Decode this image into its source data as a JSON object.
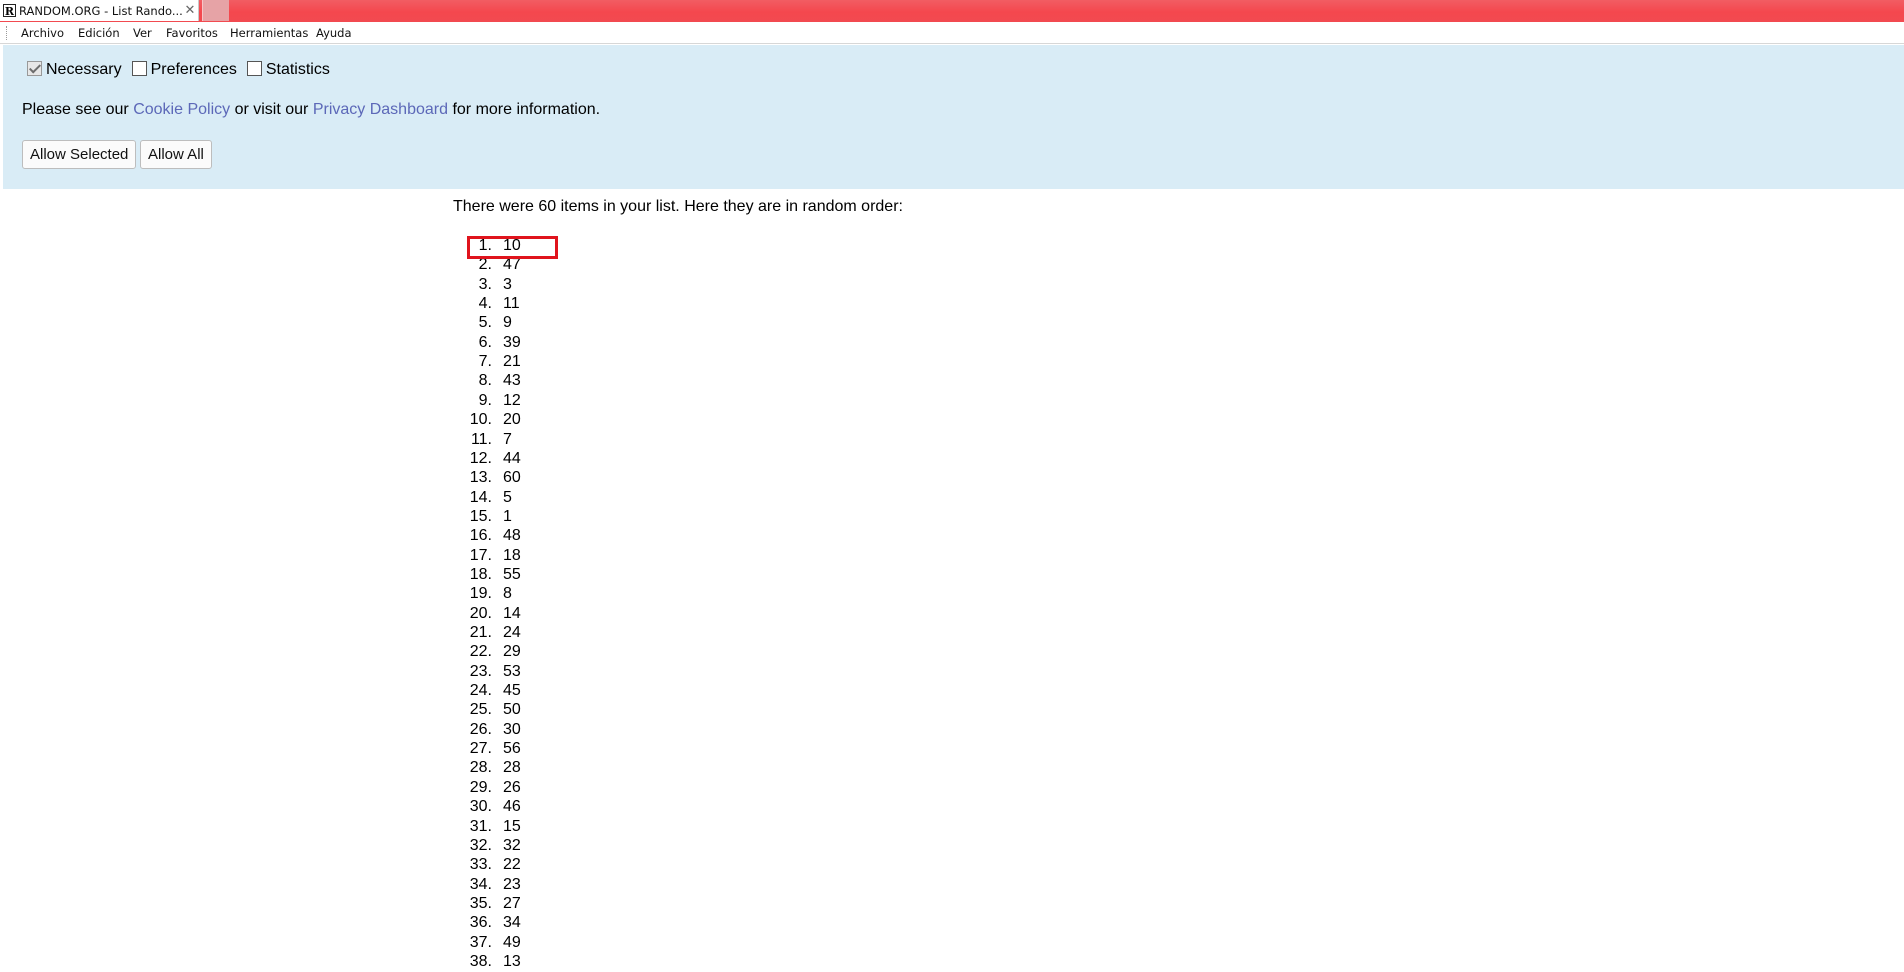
{
  "browser": {
    "tab_title": "RANDOM.ORG - List Rando...",
    "tab_icon_letter": "R",
    "close_glyph": "✕",
    "menu": [
      "Archivo",
      "Edición",
      "Ver",
      "Favoritos",
      "Herramientas",
      "Ayuda"
    ]
  },
  "cookie_banner": {
    "checkboxes": [
      {
        "label": "Necessary",
        "checked": true
      },
      {
        "label": "Preferences",
        "checked": false
      },
      {
        "label": "Statistics",
        "checked": false
      }
    ],
    "info_prefix": "Please see our",
    "cookie_policy_link": "Cookie Policy",
    "info_middle": "or visit our",
    "privacy_link": "Privacy Dashboard",
    "info_suffix": "for more information.",
    "allow_selected": "Allow Selected",
    "allow_all": "Allow All"
  },
  "content": {
    "intro": "There were 60 items in your list. Here they are in random order:",
    "items": [
      "10",
      "47",
      "3",
      "11",
      "9",
      "39",
      "21",
      "43",
      "12",
      "20",
      "7",
      "44",
      "60",
      "5",
      "1",
      "48",
      "18",
      "55",
      "8",
      "14",
      "24",
      "29",
      "53",
      "45",
      "50",
      "30",
      "56",
      "28",
      "26",
      "46",
      "15",
      "32",
      "22",
      "23",
      "27",
      "34",
      "49",
      "13"
    ],
    "highlighted_index": 0
  },
  "colors": {
    "tabbar": "#f4474e",
    "banner_bg": "#d9ecf6",
    "link": "#5c68b8",
    "highlight": "#e0141d"
  }
}
